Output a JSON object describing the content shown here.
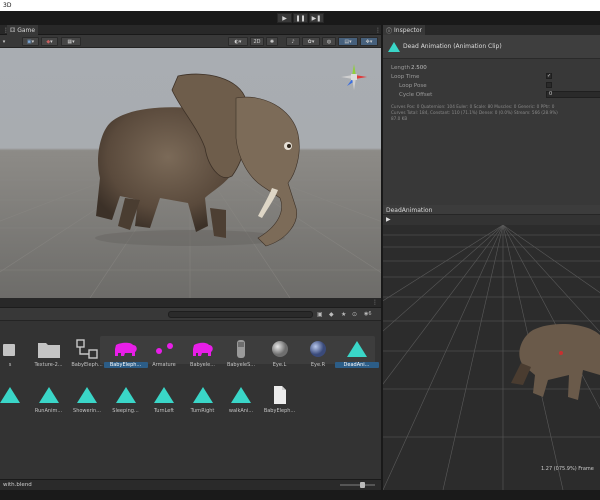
{
  "window": {
    "title": "3D"
  },
  "toolbar": {
    "play": "▶",
    "pause": "❚❚",
    "step": "▶❚"
  },
  "game_view": {
    "tab_label": "Game",
    "toolbar": {
      "gizmo_2d": "2D"
    }
  },
  "inspector": {
    "tab_label": "Inspector",
    "title": "Dead Animation (Animation Clip)",
    "length_label": "Length",
    "length_value": "2.500",
    "loop_time_label": "Loop Time",
    "loop_time_checked": "✓",
    "loop_pose_label": "Loop Pose",
    "cycle_offset_label": "Cycle Offset",
    "cycle_offset_value": "0",
    "curves_info_line1": "Curves Pos: 0 Quaternion: 104 Euler: 0 Scale: 80 Muscles: 0 Generic: 0 PPtr: 0",
    "curves_info_line2": "Curves Total: 184, Constant: 110 (71.1%) Dense: 0 (0.0%) Stream: 566 (28.9%)",
    "curves_info_line3": "87.0 KB"
  },
  "preview": {
    "title": "DeadAnimation",
    "play": "▶",
    "time_readout": "1.27 (075.9%) Frame"
  },
  "project": {
    "zoom": "6",
    "assets_row1": [
      {
        "label": "s",
        "kind": "folder-partial"
      },
      {
        "label": "Texture-2...",
        "kind": "folder"
      },
      {
        "label": "BabyEleph...",
        "kind": "prefab-tree"
      },
      {
        "label": "BabyEleph...",
        "kind": "model",
        "selected": true
      },
      {
        "label": "Armature",
        "kind": "armature"
      },
      {
        "label": "Babyele...",
        "kind": "mesh"
      },
      {
        "label": "BabyeleS...",
        "kind": "skin"
      },
      {
        "label": "Eye.L",
        "kind": "sphere-grey"
      },
      {
        "label": "Eye.R",
        "kind": "sphere-blue"
      },
      {
        "label": "DeadAni...",
        "kind": "anim",
        "selected": true
      }
    ],
    "assets_row2": [
      {
        "label": "",
        "kind": "anim"
      },
      {
        "label": "RunAnim...",
        "kind": "anim"
      },
      {
        "label": "Showerin...",
        "kind": "anim"
      },
      {
        "label": "Sleeping...",
        "kind": "anim"
      },
      {
        "label": "TurnLeft",
        "kind": "anim"
      },
      {
        "label": "TurnRight",
        "kind": "anim"
      },
      {
        "label": "walkAni...",
        "kind": "anim"
      },
      {
        "label": "BabyEleph...",
        "kind": "document"
      }
    ],
    "status_path": "with.blend"
  },
  "colors": {
    "anim_teal": "#3ad6c8",
    "magenta": "#e81ee8",
    "selection": "#2c5d87"
  }
}
